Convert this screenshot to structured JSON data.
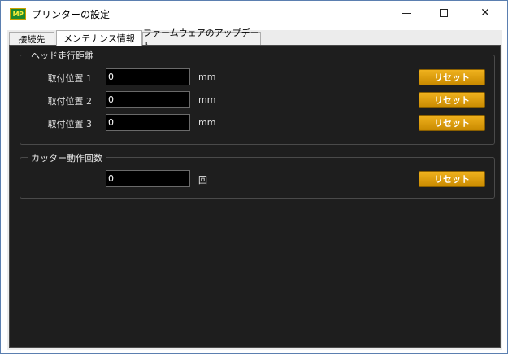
{
  "window": {
    "title": "プリンターの設定",
    "app_icon_text": "MP"
  },
  "tabs": [
    {
      "label": "接続先"
    },
    {
      "label": "メンテナンス情報",
      "active": true
    },
    {
      "label": "ファームウェアのアップデート"
    }
  ],
  "head_travel": {
    "title": "ヘッド走行距離",
    "rows": [
      {
        "label": "取付位置 1",
        "value": "0",
        "unit": "mm",
        "reset_label": "リセット"
      },
      {
        "label": "取付位置 2",
        "value": "0",
        "unit": "mm",
        "reset_label": "リセット"
      },
      {
        "label": "取付位置 3",
        "value": "0",
        "unit": "mm",
        "reset_label": "リセット"
      }
    ]
  },
  "cutter": {
    "title": "カッター動作回数",
    "value": "0",
    "unit": "回",
    "reset_label": "リセット"
  },
  "colors": {
    "panel_bg": "#1e1e1e",
    "reset_button": "#e0a010",
    "input_bg": "#000000"
  }
}
